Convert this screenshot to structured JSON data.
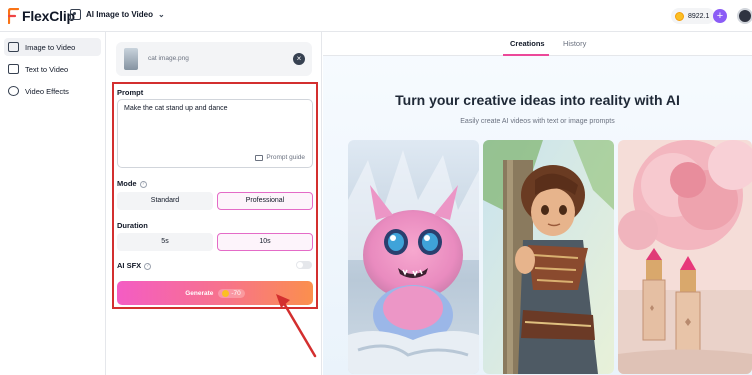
{
  "header": {
    "logo_text": "FlexClip",
    "mode_label": "AI Image to Video",
    "credits": "8922.1",
    "plus_label": "+"
  },
  "sidebar": {
    "items": [
      {
        "label": "Image to Video",
        "icon": "image-icon",
        "active": true
      },
      {
        "label": "Text to Video",
        "icon": "text-icon",
        "active": false
      },
      {
        "label": "Video Effects",
        "icon": "effects-icon",
        "active": false
      }
    ]
  },
  "panel": {
    "file_name": "cat image.png",
    "prompt_label": "Prompt",
    "prompt_text": "Make the cat stand up and dance",
    "prompt_guide": "Prompt guide",
    "mode_label": "Mode",
    "mode_options": [
      "Standard",
      "Professional"
    ],
    "mode_selected": "Professional",
    "duration_label": "Duration",
    "duration_options": [
      "5s",
      "10s"
    ],
    "duration_selected": "10s",
    "sfx_label": "AI SFX",
    "sfx_enabled": false,
    "generate_label": "Generate",
    "generate_cost": "-70"
  },
  "main": {
    "tabs": [
      "Creations",
      "History"
    ],
    "active_tab": "Creations",
    "title": "Turn your creative ideas into reality with AI",
    "subtitle": "Easily create AI videos with text or image prompts"
  },
  "colors": {
    "accent_pink": "#ec4899",
    "annotation_red": "#d32f2f",
    "plus_purple": "#8b5cf6"
  }
}
